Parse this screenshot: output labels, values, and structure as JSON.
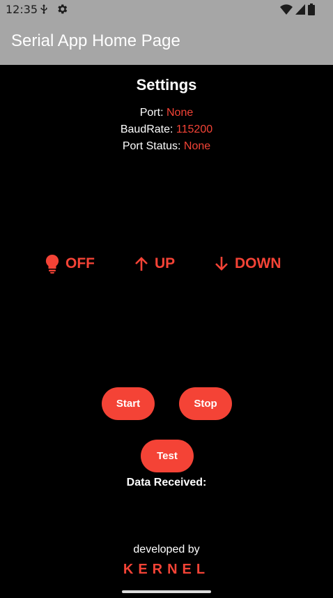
{
  "status_bar": {
    "time": "12:35",
    "icons": [
      "usb-icon",
      "gear-icon",
      "wifi-icon",
      "signal-icon",
      "battery-icon"
    ]
  },
  "app_bar": {
    "title": "Serial App Home Page",
    "background": "#a6a6a6"
  },
  "settings": {
    "title": "Settings",
    "port_label": "Port:",
    "port_value": "None",
    "baud_label": "BaudRate:",
    "baud_value": "115200",
    "status_label": "Port Status:",
    "status_value": "None"
  },
  "controls": {
    "off": {
      "label": "OFF",
      "icon": "lightbulb-icon"
    },
    "up": {
      "label": "UP",
      "icon": "arrow-up-icon"
    },
    "down": {
      "label": "DOWN",
      "icon": "arrow-down-icon"
    }
  },
  "buttons": {
    "start": "Start",
    "stop": "Stop",
    "test": "Test"
  },
  "data_received_label": "Data Received:",
  "footer": {
    "developed_by": "developed by",
    "brand": "KERNEL"
  },
  "colors": {
    "accent": "#f44336",
    "background": "#000000",
    "text": "#ffffff"
  }
}
